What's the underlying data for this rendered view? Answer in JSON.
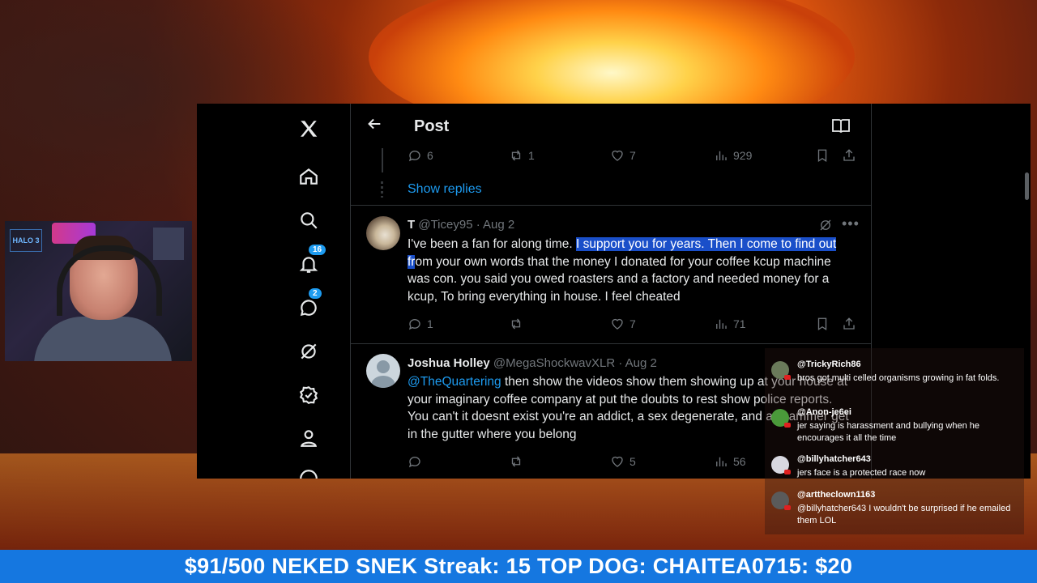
{
  "app": {
    "page_title": "Post"
  },
  "nav": {
    "notifications_badge": "16",
    "messages_badge": "2"
  },
  "top_reply_actions": {
    "replies": "6",
    "reposts": "1",
    "likes": "7",
    "views": "929"
  },
  "show_replies_label": "Show replies",
  "posts": [
    {
      "display_name": "T",
      "handle": "@Ticey95",
      "date": "· Aug 2",
      "text_before": "I've been a fan for along time. ",
      "text_highlight": "I support you for years. Then I come to find out fr",
      "text_after": "om your own words that the money I donated for your coffee kcup machine was con. you said you owed roasters and a factory and needed money for a kcup, To bring everything in house.  I feel cheated",
      "replies": "1",
      "reposts": "",
      "likes": "7",
      "views": "71"
    },
    {
      "display_name": "Joshua Holley",
      "handle": "@MegaShockwavXLR",
      "date": "· Aug 2",
      "mention": "@TheQuartering",
      "text": " then show the videos show them showing up at your house at your imaginary coffee company at put the doubts to rest show police reports. You can't it doesnt exist you're an addict, a sex degenerate, and a scammer get in the gutter where you belong",
      "replies": "",
      "reposts": "",
      "likes": "5",
      "views": "56"
    }
  ],
  "chat": [
    {
      "user": "@TrickyRich86",
      "text": "bros got multi celled organisms growing in fat folds.",
      "avatar_color": "#6a7a5a"
    },
    {
      "user": "@Anon-je6ei",
      "text": "jer saying is harassment and bullying when he encourages it all the time",
      "avatar_color": "#4a9a3a"
    },
    {
      "user": "@billyhatcher643",
      "text": "jers face is a protected race now",
      "avatar_color": "#d8d8e0"
    },
    {
      "user": "@arttheclown1163",
      "text": "@billyhatcher643 I wouldn't be surprised if he emailed them LOL",
      "avatar_color": "#5a5a5a"
    }
  ],
  "webcam": {
    "sign_text": "HALO 3"
  },
  "ticker": {
    "text": "$91/500 NEKED SNEK Streak: 15 TOP DOG: CHAITEA0715: $20"
  },
  "colors": {
    "accent": "#1d9bf0",
    "ticker_bg": "#1577e0",
    "highlight": "#1a4fc9"
  }
}
